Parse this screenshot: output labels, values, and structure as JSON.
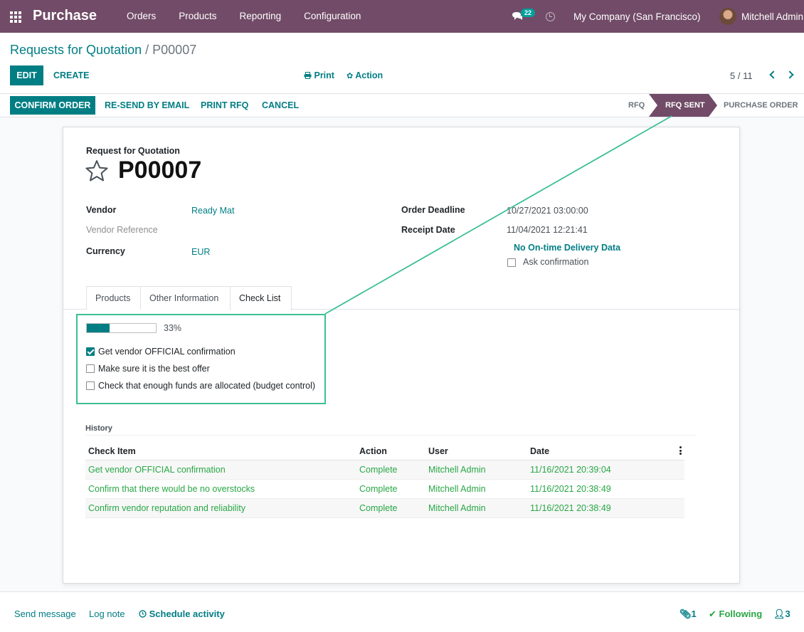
{
  "navbar": {
    "app_name": "Purchase",
    "menu": [
      "Orders",
      "Products",
      "Reporting",
      "Configuration"
    ],
    "message_count": "22",
    "company": "My Company (San Francisco)",
    "user": "Mitchell Admin"
  },
  "breadcrumb": {
    "parent": "Requests for Quotation",
    "separator": "/",
    "current": "P00007"
  },
  "controls": {
    "edit": "EDIT",
    "create": "CREATE",
    "print": "Print",
    "action": "Action",
    "pager": "5 / 11"
  },
  "statusbar": {
    "buttons": [
      "CONFIRM ORDER",
      "RE-SEND BY EMAIL",
      "PRINT RFQ",
      "CANCEL"
    ],
    "stages": [
      "RFQ",
      "RFQ SENT",
      "PURCHASE ORDER"
    ],
    "active_stage": "RFQ SENT"
  },
  "form": {
    "doc_type": "Request for Quotation",
    "name": "P00007",
    "vendor_label": "Vendor",
    "vendor": "Ready Mat",
    "vendor_ref_label": "Vendor Reference",
    "currency_label": "Currency",
    "currency": "EUR",
    "deadline_label": "Order Deadline",
    "deadline": "10/27/2021 03:00:00",
    "receipt_label": "Receipt Date",
    "receipt": "11/04/2021 12:21:41",
    "delivery_data": "No On-time Delivery Data",
    "ask_confirmation": "Ask confirmation"
  },
  "tabs": [
    "Products",
    "Other Information",
    "Check List"
  ],
  "active_tab": "Check List",
  "checklist": {
    "progress": 0.33,
    "progress_text": "33%",
    "items": [
      {
        "label": "Get vendor OFFICIAL confirmation",
        "checked": true
      },
      {
        "label": "Make sure it is the best offer",
        "checked": false
      },
      {
        "label": "Check that enough funds are allocated (budget control)",
        "checked": false
      }
    ]
  },
  "history": {
    "label": "History",
    "columns": [
      "Check Item",
      "Action",
      "User",
      "Date"
    ],
    "rows": [
      [
        "Get vendor OFFICIAL confirmation",
        "Complete",
        "Mitchell Admin",
        "11/16/2021 20:39:04"
      ],
      [
        "Confirm that there would be no overstocks",
        "Complete",
        "Mitchell Admin",
        "11/16/2021 20:38:49"
      ],
      [
        "Confirm vendor reputation and reliability",
        "Complete",
        "Mitchell Admin",
        "11/16/2021 20:38:49"
      ]
    ]
  },
  "chatter": {
    "send_message": "Send message",
    "log_note": "Log note",
    "schedule_activity": "Schedule activity",
    "attachments": "1",
    "following": "Following",
    "followers": "3"
  },
  "colors": {
    "brand": "#714b67",
    "accent": "#017e84",
    "highlight": "#3cbf96",
    "success": "#28a745"
  }
}
